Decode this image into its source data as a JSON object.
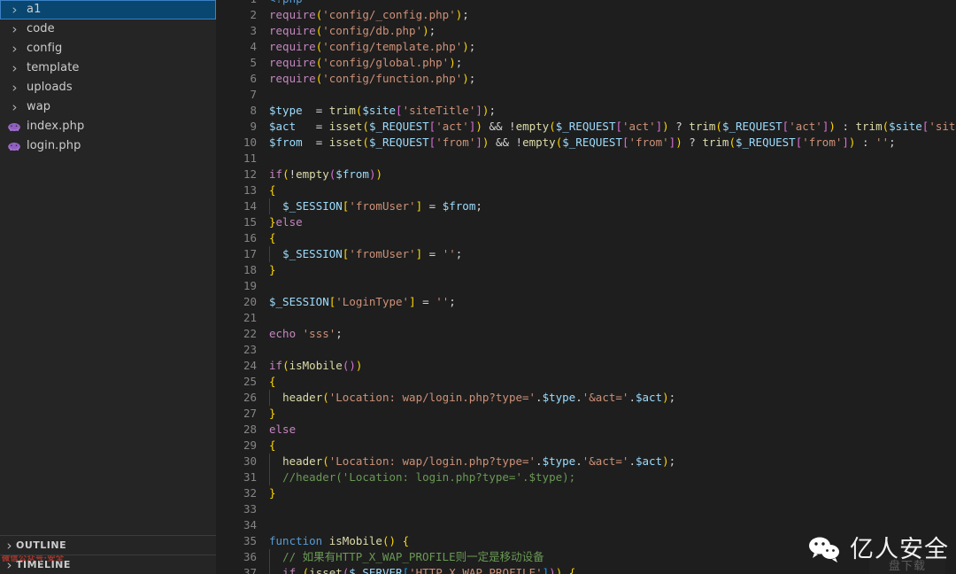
{
  "sidebar": {
    "tree": [
      {
        "label": "a1",
        "type": "folder",
        "icon": "chevron-right-icon",
        "selected": true
      },
      {
        "label": "code",
        "type": "folder",
        "icon": "chevron-right-icon",
        "selected": false
      },
      {
        "label": "config",
        "type": "folder",
        "icon": "chevron-right-icon",
        "selected": false
      },
      {
        "label": "template",
        "type": "folder",
        "icon": "chevron-right-icon",
        "selected": false
      },
      {
        "label": "uploads",
        "type": "folder",
        "icon": "chevron-right-icon",
        "selected": false
      },
      {
        "label": "wap",
        "type": "folder",
        "icon": "chevron-right-icon",
        "selected": false
      },
      {
        "label": "index.php",
        "type": "file",
        "icon": "php-elephant-icon",
        "selected": false
      },
      {
        "label": "login.php",
        "type": "file",
        "icon": "php-elephant-icon",
        "selected": false
      }
    ],
    "panes": [
      {
        "label": "OUTLINE"
      },
      {
        "label": "TIMELINE"
      }
    ]
  },
  "editor": {
    "language": "php",
    "first_visible_line": 1,
    "last_visible_line": 37,
    "lines": [
      {
        "n": 1,
        "text": "<?php"
      },
      {
        "n": 2,
        "text": "require('config/_config.php');"
      },
      {
        "n": 3,
        "text": "require('config/db.php');"
      },
      {
        "n": 4,
        "text": "require('config/template.php');"
      },
      {
        "n": 5,
        "text": "require('config/global.php');"
      },
      {
        "n": 6,
        "text": "require('config/function.php');"
      },
      {
        "n": 7,
        "text": ""
      },
      {
        "n": 8,
        "text": "$type  = trim($site['siteTitle']);"
      },
      {
        "n": 9,
        "text": "$act   = isset($_REQUEST['act']) && !empty($_REQUEST['act']) ? trim($_REQUEST['act']) : trim($site['siteKeyw"
      },
      {
        "n": 10,
        "text": "$from  = isset($_REQUEST['from']) && !empty($_REQUEST['from']) ? trim($_REQUEST['from']) : '';"
      },
      {
        "n": 11,
        "text": ""
      },
      {
        "n": 12,
        "text": "if(!empty($from))"
      },
      {
        "n": 13,
        "text": "{"
      },
      {
        "n": 14,
        "text": "  $_SESSION['fromUser'] = $from;"
      },
      {
        "n": 15,
        "text": "}else"
      },
      {
        "n": 16,
        "text": "{"
      },
      {
        "n": 17,
        "text": "  $_SESSION['fromUser'] = '';"
      },
      {
        "n": 18,
        "text": "}"
      },
      {
        "n": 19,
        "text": ""
      },
      {
        "n": 20,
        "text": "$_SESSION['LoginType'] = '';"
      },
      {
        "n": 21,
        "text": ""
      },
      {
        "n": 22,
        "text": "echo 'sss';"
      },
      {
        "n": 23,
        "text": ""
      },
      {
        "n": 24,
        "text": "if(isMobile())"
      },
      {
        "n": 25,
        "text": "{"
      },
      {
        "n": 26,
        "text": "  header('Location: wap/login.php?type='.$type.'&act='.$act);"
      },
      {
        "n": 27,
        "text": "}"
      },
      {
        "n": 28,
        "text": "else"
      },
      {
        "n": 29,
        "text": "{"
      },
      {
        "n": 30,
        "text": "  header('Location: wap/login.php?type='.$type.'&act='.$act);"
      },
      {
        "n": 31,
        "text": "  //header('Location: login.php?type='.$type);"
      },
      {
        "n": 32,
        "text": "}"
      },
      {
        "n": 33,
        "text": ""
      },
      {
        "n": 34,
        "text": ""
      },
      {
        "n": 35,
        "text": "function isMobile() {"
      },
      {
        "n": 36,
        "text": "  // 如果有HTTP_X_WAP_PROFILE则一定是移动设备"
      },
      {
        "n": 37,
        "text": "  if (isset($_SERVER['HTTP_X_WAP_PROFILE'])) {"
      }
    ]
  },
  "watermarks": {
    "wechat_brand": "亿人安全",
    "wechat_icon": "wechat-logo-icon",
    "corner_label": "盘下载",
    "red_overlay": "微信公众号·安全"
  },
  "colors": {
    "editor_background": "#1e1e1e",
    "sidebar_background": "#252526",
    "selection_blue": "#094771",
    "selection_border": "#3b82c4",
    "line_number": "#858585",
    "string": "#ce9178",
    "keyword": "#c586c0",
    "function": "#dcdcaa",
    "variable": "#9cdcfe",
    "comment": "#6a9955",
    "php_icon": "#8892bf"
  }
}
